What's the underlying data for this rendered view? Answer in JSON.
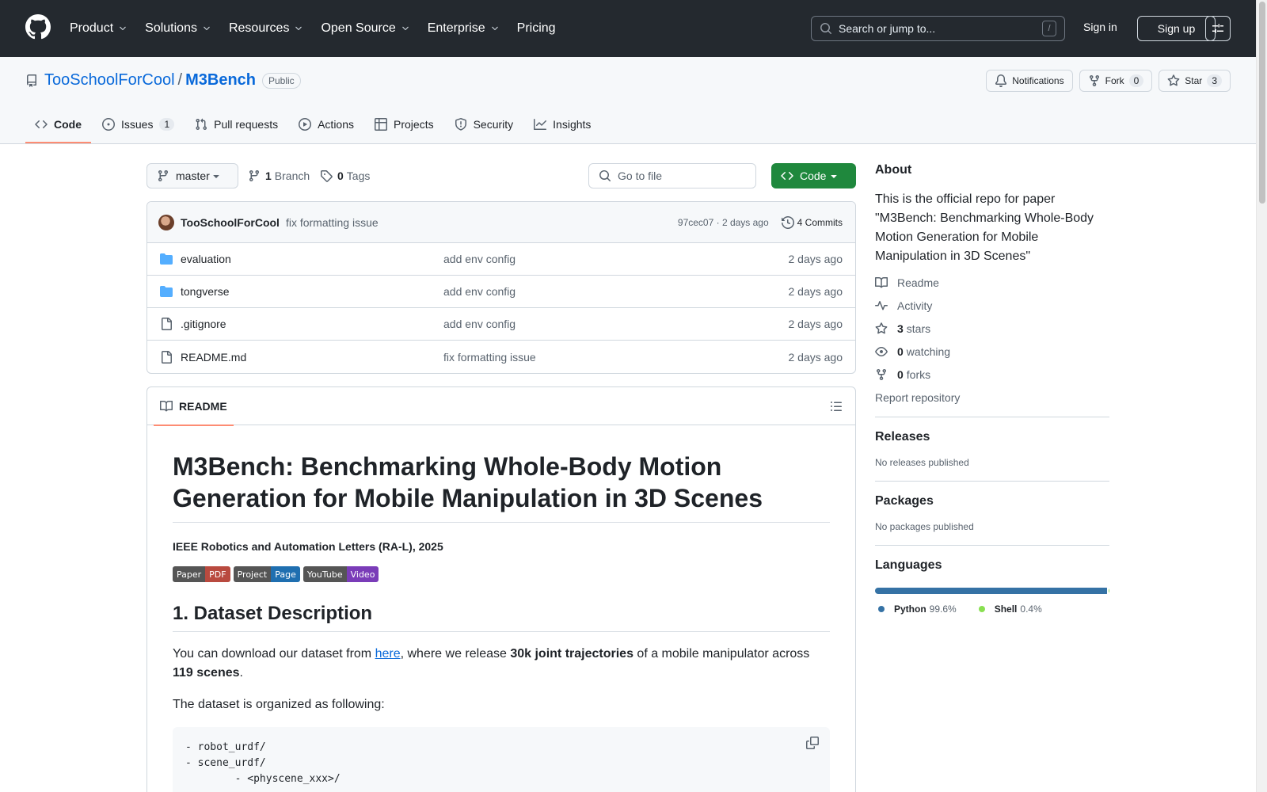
{
  "header": {
    "nav": [
      {
        "label": "Product",
        "dropdown": true
      },
      {
        "label": "Solutions",
        "dropdown": true
      },
      {
        "label": "Resources",
        "dropdown": true
      },
      {
        "label": "Open Source",
        "dropdown": true
      },
      {
        "label": "Enterprise",
        "dropdown": true
      },
      {
        "label": "Pricing",
        "dropdown": false
      }
    ],
    "search_placeholder": "Search or jump to...",
    "search_shortcut": "/",
    "sign_in": "Sign in",
    "sign_up": "Sign up"
  },
  "repo": {
    "owner": "TooSchoolForCool",
    "separator": "/",
    "name": "M3Bench",
    "visibility": "Public",
    "notifications_label": "Notifications",
    "fork_label": "Fork",
    "fork_count": "0",
    "star_label": "Star",
    "star_count": "3"
  },
  "tabs": [
    {
      "label": "Code",
      "icon": "code-icon",
      "active": true,
      "count": ""
    },
    {
      "label": "Issues",
      "icon": "issue-icon",
      "active": false,
      "count": "1"
    },
    {
      "label": "Pull requests",
      "icon": "pull-request-icon",
      "active": false,
      "count": ""
    },
    {
      "label": "Actions",
      "icon": "play-icon",
      "active": false,
      "count": ""
    },
    {
      "label": "Projects",
      "icon": "table-icon",
      "active": false,
      "count": ""
    },
    {
      "label": "Security",
      "icon": "shield-icon",
      "active": false,
      "count": ""
    },
    {
      "label": "Insights",
      "icon": "graph-icon",
      "active": false,
      "count": ""
    }
  ],
  "toolbar": {
    "branch": "master",
    "branch_count": "1",
    "branch_label": "Branch",
    "tag_count": "0",
    "tag_label": "Tags",
    "goto_placeholder": "Go to file",
    "code_button": "Code"
  },
  "latest_commit": {
    "author": "TooSchoolForCool",
    "message": "fix formatting issue",
    "meta": "97cec07 · 2 days ago",
    "commits_label": "4 Commits"
  },
  "files": [
    {
      "name": "evaluation",
      "type": "dir",
      "message": "add env config",
      "date": "2 days ago"
    },
    {
      "name": "tongverse",
      "type": "dir",
      "message": "add env config",
      "date": "2 days ago"
    },
    {
      "name": ".gitignore",
      "type": "file",
      "message": "add env config",
      "date": "2 days ago"
    },
    {
      "name": "README.md",
      "type": "file",
      "message": "fix formatting issue",
      "date": "2 days ago"
    }
  ],
  "readme": {
    "tab_label": "README",
    "title": "M3Bench: Benchmarking Whole-Body Motion Generation for Mobile Manipulation in 3D Scenes",
    "venue": "IEEE Robotics and Automation Letters (RA-L), 2025",
    "badges": [
      {
        "left": "Paper",
        "right": "PDF",
        "left_color": "#555555",
        "right_color": "#b94a3f"
      },
      {
        "left": "Project",
        "right": "Page",
        "left_color": "#555555",
        "right_color": "#1f6fb0"
      },
      {
        "left": "YouTube",
        "right": "Video",
        "left_color": "#555555",
        "right_color": "#7a3cb8"
      }
    ],
    "section_title": "1. Dataset Description",
    "p1_before": "You can download our dataset from ",
    "p1_link": "here",
    "p1_mid": ", where we release ",
    "p1_bold1": "30k joint trajectories",
    "p1_after": " of a mobile manipulator across ",
    "p1_bold2": "119 scenes",
    "p1_end": ".",
    "p2": "The dataset is organized as following:",
    "code_lines": [
      "- robot_urdf/",
      "- scene_urdf/",
      "        - <physcene_xxx>/"
    ]
  },
  "sidebar": {
    "about_title": "About",
    "description": "This is the official repo for paper \"M3Bench: Benchmarking Whole-Body Motion Generation for Mobile Manipulation in 3D Scenes\"",
    "links": [
      {
        "icon": "book-icon",
        "count": "",
        "label": "Readme"
      },
      {
        "icon": "pulse-icon",
        "count": "",
        "label": "Activity"
      },
      {
        "icon": "star-icon",
        "count": "3",
        "label": "stars"
      },
      {
        "icon": "eye-icon",
        "count": "0",
        "label": "watching"
      },
      {
        "icon": "fork-icon",
        "count": "0",
        "label": "forks"
      }
    ],
    "report": "Report repository",
    "releases_title": "Releases",
    "releases_note": "No releases published",
    "packages_title": "Packages",
    "packages_note": "No packages published",
    "languages_title": "Languages",
    "languages": [
      {
        "name": "Python",
        "percent": "99.6%",
        "value": 99.6,
        "color": "#3572A5"
      },
      {
        "name": "Shell",
        "percent": "0.4%",
        "value": 0.4,
        "color": "#89e051"
      }
    ]
  }
}
